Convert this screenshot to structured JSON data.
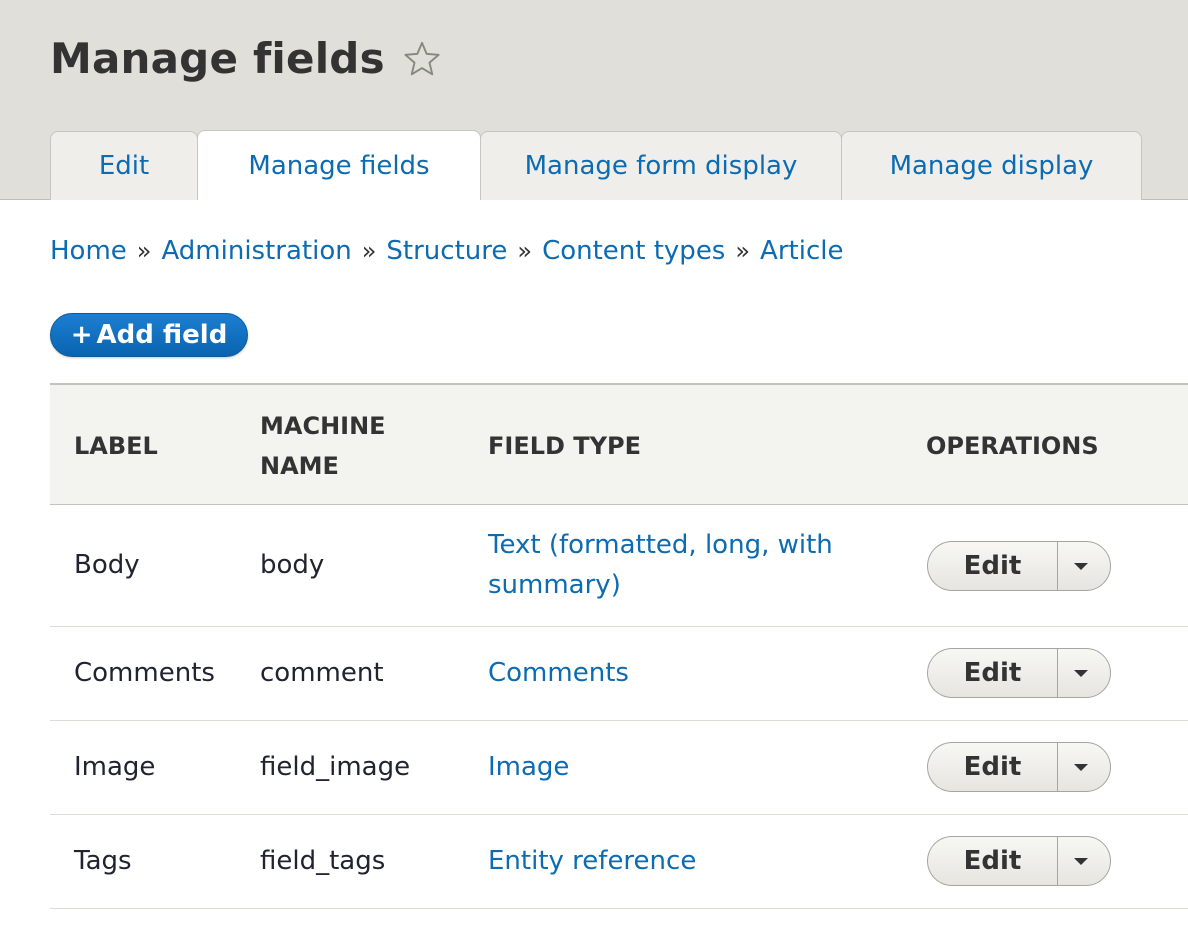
{
  "page": {
    "title": "Manage fields"
  },
  "tabs": [
    {
      "label": "Edit",
      "active": false
    },
    {
      "label": "Manage fields",
      "active": true
    },
    {
      "label": "Manage form display",
      "active": false
    },
    {
      "label": "Manage display",
      "active": false
    }
  ],
  "breadcrumb": {
    "separator": "»",
    "items": [
      "Home",
      "Administration",
      "Structure",
      "Content types",
      "Article"
    ]
  },
  "actions": {
    "add_field_plus": "+",
    "add_field_label": "Add field"
  },
  "table": {
    "headers": {
      "label": "LABEL",
      "machine_name": "MACHINE NAME",
      "field_type": "FIELD TYPE",
      "operations": "OPERATIONS"
    },
    "rows": [
      {
        "label": "Body",
        "machine_name": "body",
        "field_type": "Text (formatted, long, with summary)",
        "operation": "Edit"
      },
      {
        "label": "Comments",
        "machine_name": "comment",
        "field_type": "Comments",
        "operation": "Edit"
      },
      {
        "label": "Image",
        "machine_name": "field_image",
        "field_type": "Image",
        "operation": "Edit"
      },
      {
        "label": "Tags",
        "machine_name": "field_tags",
        "field_type": "Entity reference",
        "operation": "Edit"
      }
    ]
  },
  "icons": {
    "favorite": "star-outline-icon",
    "dropdown": "caret-down-icon"
  },
  "colors": {
    "link": "#0d6bb1",
    "primary_button": "#0a64b0",
    "header_bg": "#e0dfd9",
    "table_head_bg": "#f3f3ef"
  }
}
